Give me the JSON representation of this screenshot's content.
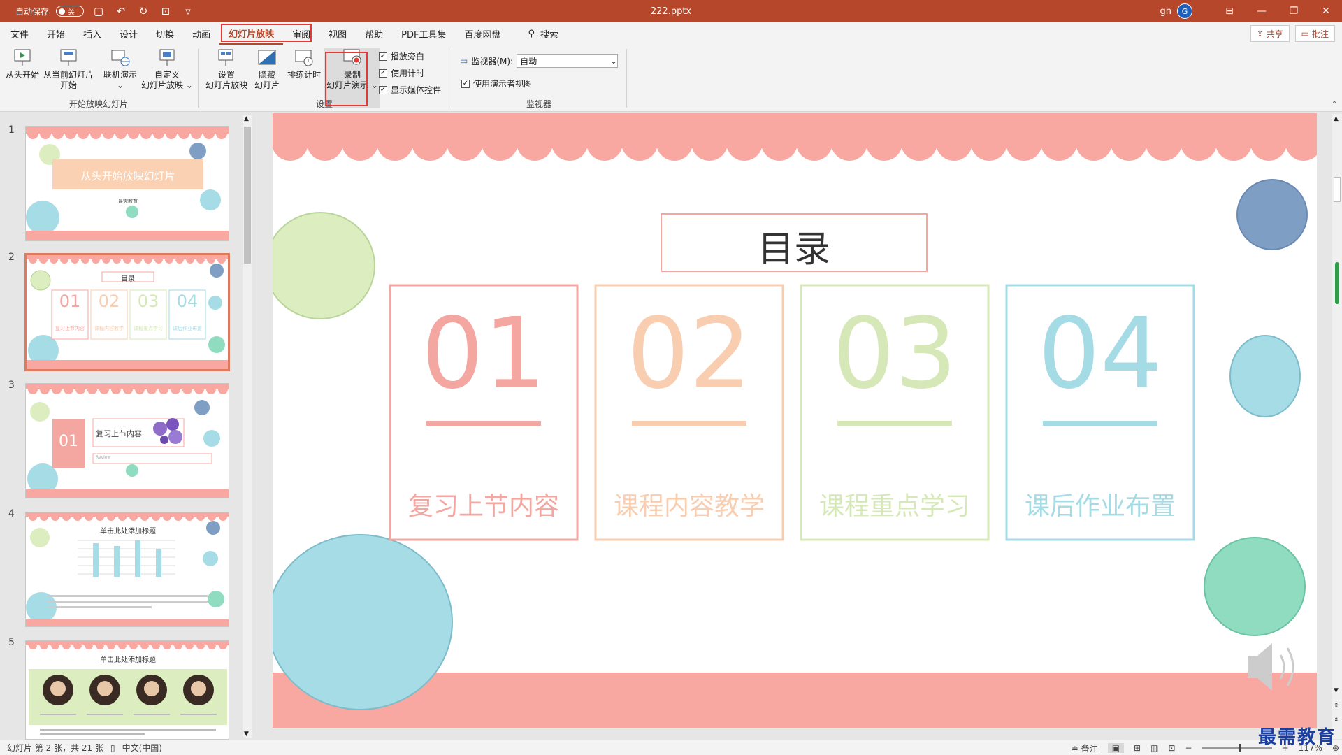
{
  "titlebar": {
    "autosave_label": "自动保存",
    "autosave_state": "关",
    "doc_title": "222.pptx",
    "user_name": "gh",
    "user_initial": "G"
  },
  "menu": {
    "tabs": [
      "文件",
      "开始",
      "插入",
      "设计",
      "切换",
      "动画",
      "幻灯片放映",
      "审阅",
      "视图",
      "帮助",
      "PDF工具集",
      "百度网盘"
    ],
    "active_tab": "幻灯片放映",
    "search_label": "搜索",
    "share_label": "共享",
    "comment_label": "批注"
  },
  "ribbon": {
    "start_group": {
      "label": "开始放映幻灯片",
      "from_beginning": "从头开始",
      "from_current_1": "从当前幻灯片",
      "from_current_2": "开始",
      "online": "联机演示",
      "custom_1": "自定义",
      "custom_2": "幻灯片放映"
    },
    "setup_group": {
      "label": "设置",
      "setup_1": "设置",
      "setup_2": "幻灯片放映",
      "hide_1": "隐藏",
      "hide_2": "幻灯片",
      "rehearse": "排练计时",
      "record_1": "录制",
      "record_2": "幻灯片演示",
      "chk_narration": "播放旁白",
      "chk_timing": "使用计时",
      "chk_media": "显示媒体控件"
    },
    "monitor_group": {
      "label": "监视器",
      "monitor_label": "监视器(M):",
      "monitor_value": "自动",
      "presenter_view": "使用演示者视图"
    }
  },
  "thumbnails": [
    {
      "num": "1",
      "title": "从头开始放映幻灯片",
      "subtitle": "最需教育"
    },
    {
      "num": "2",
      "title": "目录",
      "items": [
        "01",
        "02",
        "03",
        "04"
      ],
      "captions": [
        "复习上节内容",
        "课程内容教学",
        "课程重点学习",
        "课后作业布置"
      ]
    },
    {
      "num": "3",
      "number": "01",
      "title": "复习上节内容",
      "subtitle": "Review"
    },
    {
      "num": "4",
      "title": "单击此处添加标题"
    },
    {
      "num": "5",
      "title": "单击此处添加标题"
    }
  ],
  "slide": {
    "title": "目录",
    "items": [
      {
        "number": "01",
        "caption": "复习上节内容",
        "color": "#f4a6a0"
      },
      {
        "number": "02",
        "caption": "课程内容教学",
        "color": "#f8cdb0"
      },
      {
        "number": "03",
        "caption": "课程重点学习",
        "color": "#d6e8b8"
      },
      {
        "number": "04",
        "caption": "课后作业布置",
        "color": "#a4dbe5"
      }
    ],
    "colors": {
      "scallop": "#f8a8a0",
      "green": "#dcedc0",
      "blue": "#7f9ec4",
      "teal": "#a6dce6",
      "mint": "#8fdcc0"
    }
  },
  "status": {
    "slide_info": "幻灯片 第 2 张，共 21 张",
    "language": "中文(中国)",
    "notes": "备注",
    "zoom": "117%"
  },
  "watermark": "最需教育"
}
